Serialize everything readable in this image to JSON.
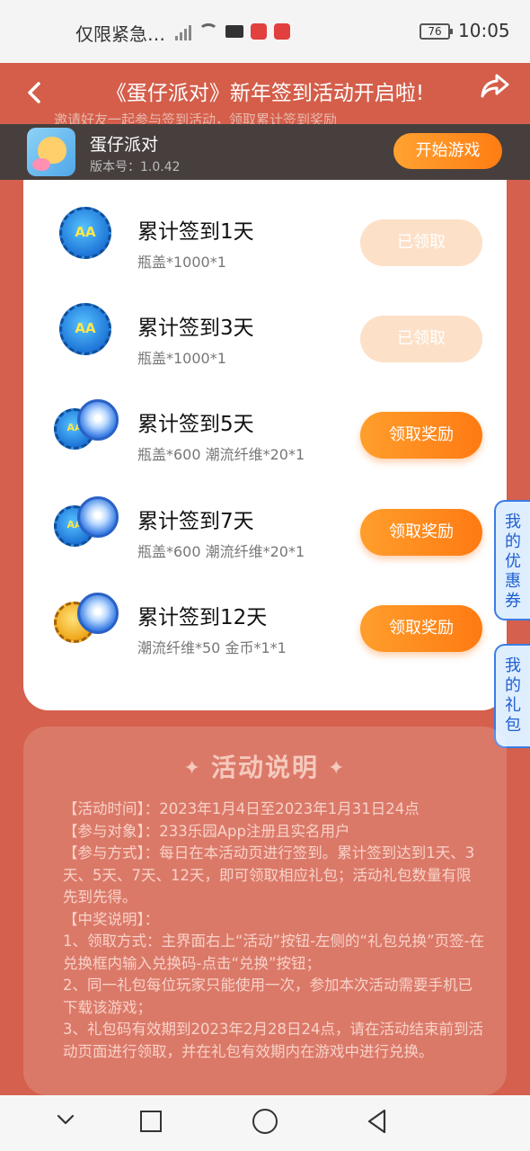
{
  "status_bar": {
    "notice": "仅限紧急…",
    "battery": "76",
    "time": "10:05"
  },
  "header": {
    "title": "《蛋仔派对》新年签到活动开启啦!",
    "hint_text": "邀请好友一起参与签到活动，领取累计签到奖励"
  },
  "app_bar": {
    "name": "蛋仔派对",
    "version": "版本号：1.0.42",
    "start_label": "开始游戏"
  },
  "rewards": [
    {
      "title": "累计签到1天",
      "desc": "瓶盖*1000*1",
      "button": "已领取",
      "state": "claimed"
    },
    {
      "title": "累计签到3天",
      "desc": "瓶盖*1000*1",
      "button": "已领取",
      "state": "claimed"
    },
    {
      "title": "累计签到5天",
      "desc": "瓶盖*600 潮流纤维*20*1",
      "button": "领取奖励",
      "state": "claim"
    },
    {
      "title": "累计签到7天",
      "desc": "瓶盖*600 潮流纤维*20*1",
      "button": "领取奖励",
      "state": "claim"
    },
    {
      "title": "累计签到12天",
      "desc": "潮流纤维*50 金币*1*1",
      "button": "领取奖励",
      "state": "claim"
    }
  ],
  "side_tabs": {
    "coupon": [
      "我",
      "的",
      "优",
      "惠",
      "券"
    ],
    "gift": [
      "我",
      "的",
      "礼",
      "包"
    ]
  },
  "description": {
    "heading": "活动说明",
    "lines": [
      "【活动时间】：2023年1月4日至2023年1月31日24点",
      "【参与对象】：233乐园App注册且实名用户",
      "【参与方式】：每日在本活动页进行签到。累计签到达到1天、3天、5天、7天、12天，即可领取相应礼包；活动礼包数量有限先到先得。",
      "【中奖说明】：",
      "1、领取方式：主界面右上“活动”按钮-左侧的“礼包兑换”页签-在兑换框内输入兑换码-点击“兑换”按钮；",
      "2、同一礼包每位玩家只能使用一次，参加本次活动需要手机已下载该游戏；",
      "3、礼包码有效期到2023年2月28日24点，请在活动结束前到活动页面进行领取，并在礼包有效期内在游戏中进行兑换。"
    ]
  },
  "colors": {
    "page_bg": "#d4604d",
    "accent_orange": "#ff8a1f",
    "claimed_btn": "#fde0c8",
    "side_tab_blue": "#3b7de6"
  }
}
